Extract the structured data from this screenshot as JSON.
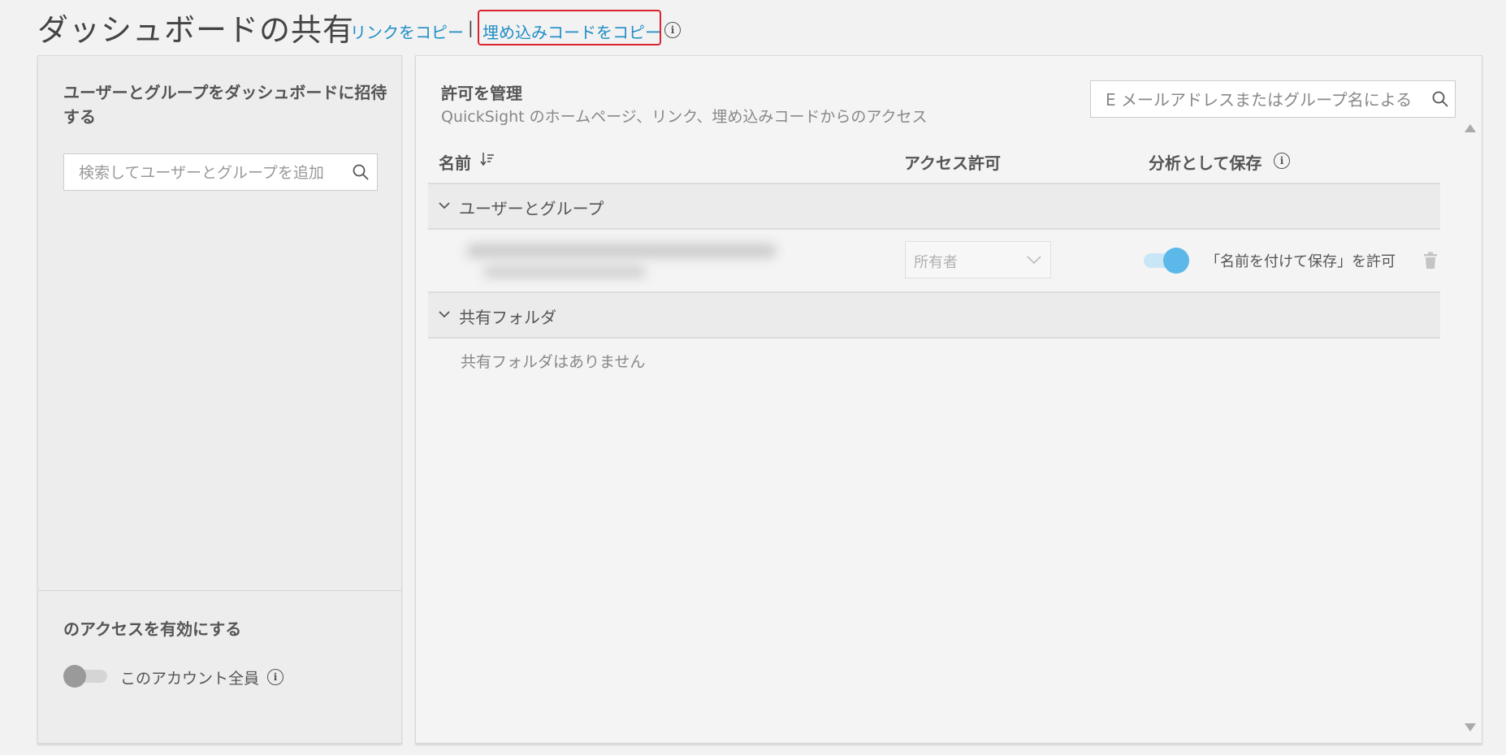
{
  "header": {
    "title": "ダッシュボードの共有",
    "copy_link": "リンクをコピー",
    "separator": "|",
    "copy_embed": "埋め込みコードをコピー"
  },
  "left_panel": {
    "invite_title": "ユーザーとグループをダッシュボードに招待する",
    "search_placeholder": "検索してユーザーとグループを追加",
    "access_title": "のアクセスを有効にする",
    "everyone_label": "このアカウント全員",
    "everyone_enabled": false
  },
  "right_panel": {
    "title": "許可を管理",
    "subtitle": "QuickSight のホームページ、リンク、埋め込みコードからのアクセス",
    "search_placeholder": "E メールアドレスまたはグループ名による",
    "columns": {
      "name": "名前",
      "access": "アクセス許可",
      "save_as": "分析として保存"
    },
    "groups": [
      {
        "label": "ユーザーとグループ"
      },
      {
        "label": "共有フォルダ"
      }
    ],
    "user_row": {
      "role": "所有者",
      "save_as_enabled": true,
      "save_as_label": "「名前を付けて保存」を許可"
    },
    "empty_folders": "共有フォルダはありません"
  },
  "colors": {
    "link": "#1f8dc6",
    "highlight_border": "#d9232d",
    "toggle_on": "#5cb8e8"
  }
}
